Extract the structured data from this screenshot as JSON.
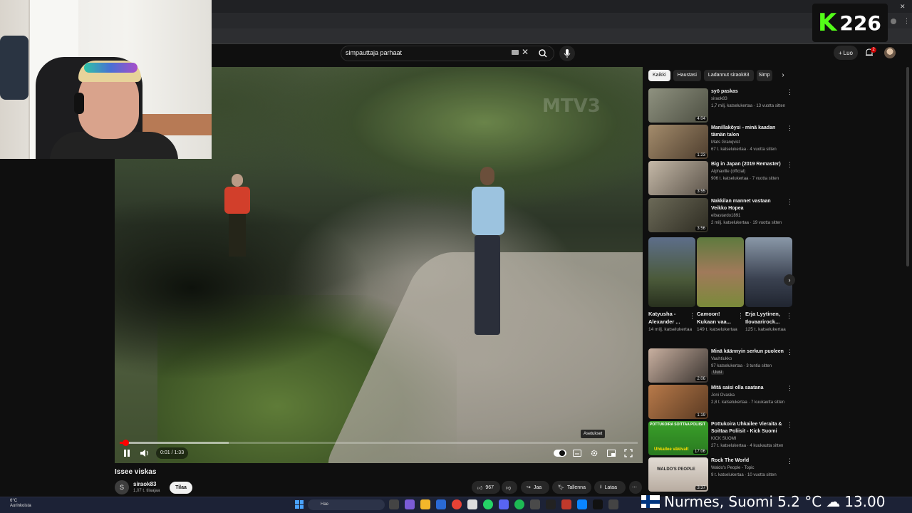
{
  "overlay": {
    "score_letter": "K",
    "score_value": "226"
  },
  "search": {
    "query": "simpauttaja parhaat"
  },
  "header": {
    "create_label": "Luo",
    "notifications_count": "2"
  },
  "player": {
    "watermark": "MTV3",
    "time": "0:01 / 1:33",
    "progress_fraction": 0.011,
    "loaded_fraction": 0.21,
    "tooltip": "Asetukset"
  },
  "video": {
    "title": "Issee viskas",
    "channel_initial": "S",
    "channel_name": "siraok83",
    "subscribers": "1,07 t. tilaajaa",
    "subscribe_label": "Tilaa",
    "likes": "967",
    "share_label": "Jaa",
    "save_label": "Tallenna",
    "download_label": "Lataa"
  },
  "chips": [
    "Kaikki",
    "Haustasi",
    "Ladannut siraok83",
    "Simp"
  ],
  "recommendations": [
    {
      "title": "syö paskas",
      "channel": "siraok83",
      "meta": "1,7 milj. katselukertaa · 13 vuotta sitten",
      "duration": "4:04",
      "color": "#6e7060"
    },
    {
      "title": "Manillaköysi - minä kaadan tämän talon",
      "channel": "Mats Granqvist",
      "meta": "67 t. katselukertaa · 4 vuotta sitten",
      "duration": "1:23",
      "color": "#7a6a55"
    },
    {
      "title": "Big in Japan (2019 Remaster)",
      "channel": "Alphaville (official)",
      "meta": "906 t. katselukertaa · 7 vuotta sitten",
      "duration": "3:55",
      "color": "#8c8c86"
    },
    {
      "title": "Nakkilan mannet vastaan Veikko Hopea",
      "channel": "elbastardo1891",
      "meta": "2 milj. katselukertaa · 19 vuotta sitten",
      "duration": "3:56",
      "color": "#5a5b4a"
    }
  ],
  "shorts": [
    {
      "title": "Katyusha - Alexander ...",
      "views": "14 milj. katselukertaa",
      "color": "#6a7a54"
    },
    {
      "title": "Camoon! Kukaan vaa...",
      "views": "149 t. katselukertaa",
      "color": "#7a8a60"
    },
    {
      "title": "Erja Lyytinen, Ilovaarirock...",
      "views": "125 t. katselukertaa",
      "color": "#707a88"
    }
  ],
  "recommendations2": [
    {
      "title": "Minä käännyin serkun puoleen",
      "channel": "Vauhtiukko",
      "meta": "97 katselukertaa · 3 tuntia sitten",
      "duration": "2:06",
      "badge": "Uusi",
      "color": "#7a6a60"
    },
    {
      "title": "Mitä saisi olla saatana",
      "channel": "Joni Ovaska",
      "meta": "2,8 t. katselukertaa · 7 kuukautta sitten",
      "duration": "1:19",
      "color": "#9a5a3a"
    },
    {
      "title": "Pottukoira Uhkailee Vieraita & Soittaa Poliisit - Kick Suomi",
      "channel": "KICK SUOMI",
      "meta": "27 t. katselukertaa · 4 kuukautta sitten",
      "duration": "17:06",
      "thumb_text": "POTTUKOIRA SOITTAA POLIISIT",
      "thumb_text2": "Uhkailee väkivalt",
      "color": "#3aa02a"
    },
    {
      "title": "Rock The World",
      "channel": "Waldo's People - Topic",
      "meta": "9 t. katselukertaa · 10 vuotta sitten",
      "duration": "3:37",
      "thumb_text": "WALDO'S PEOPLE",
      "color": "#d8d0c8"
    }
  ],
  "taskbar": {
    "temperature": "6°C",
    "weather_desc": "Aurinkoista",
    "search_placeholder": "Hae"
  },
  "ticker": {
    "location": "Nurmes, Suomi",
    "temp": "5.2 °C",
    "time": "13.00"
  }
}
